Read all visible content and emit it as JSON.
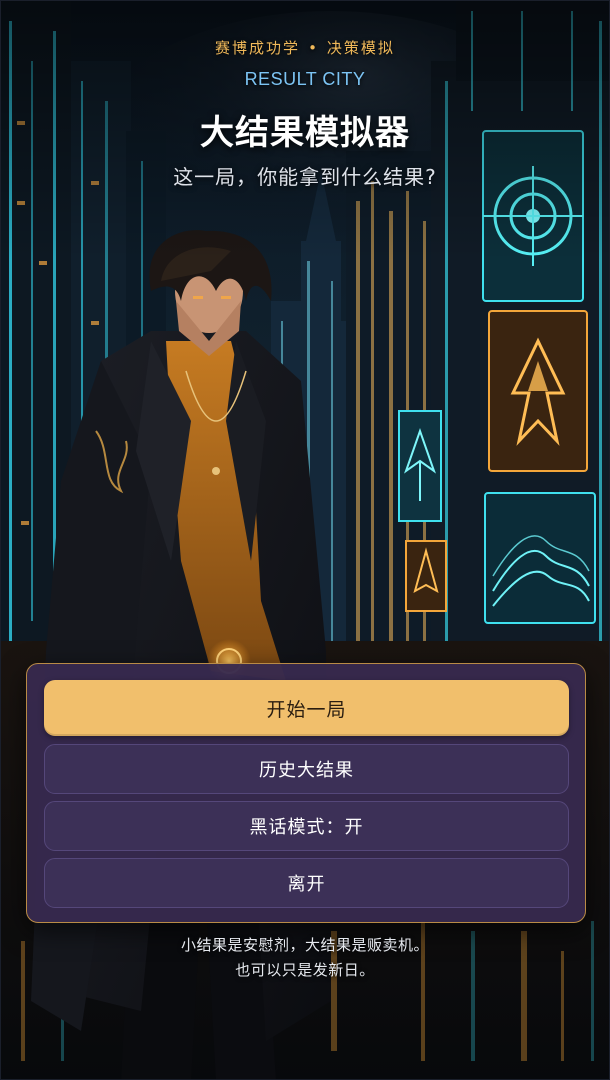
{
  "header": {
    "eyebrow_left": "赛博成功学",
    "eyebrow_separator": "•",
    "eyebrow_right": "决策模拟",
    "english_title": "RESULT CITY",
    "title": "大结果模拟器",
    "subtitle": "这一局，你能拿到什么结果?"
  },
  "menu": {
    "start_label": "开始一局",
    "history_label": "历史大结果",
    "slang_label": "黑话模式：开",
    "leave_label": "离开"
  },
  "footer": {
    "line1": "小结果是安慰剂，大结果是贩卖机。",
    "line2": "也可以只是发新日。"
  },
  "colors": {
    "accent_gold": "#f1bf6c",
    "panel_purple": "#372a4e",
    "button_purple": "#3c3057",
    "english_blue": "#7cc4f4",
    "neon_cyan": "#37d3e6",
    "neon_amber": "#f3a63a"
  },
  "scene": {
    "character": "hooded-boy-in-black-coat",
    "icons": [
      "target-sign-icon",
      "flame-crest-sign-icon",
      "tree-sign-icon",
      "wave-grid-sign-icon"
    ]
  }
}
